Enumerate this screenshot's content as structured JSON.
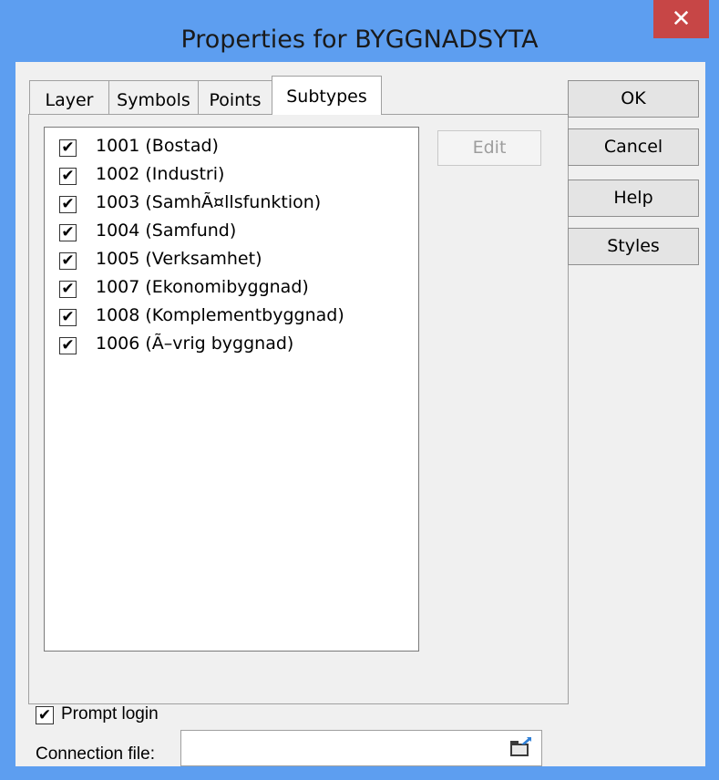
{
  "window": {
    "title": "Properties for BYGGNADSYTA",
    "close_glyph": "✕"
  },
  "tabs": [
    {
      "label": "Layer"
    },
    {
      "label": "Symbols"
    },
    {
      "label": "Points"
    },
    {
      "label": "Subtypes",
      "active": true
    }
  ],
  "subtypes": {
    "items": [
      {
        "label": "1001 (Bostad)",
        "checked": true
      },
      {
        "label": "1002 (Industri)",
        "checked": true
      },
      {
        "label": "1003 (SamhÃ¤llsfunktion)",
        "checked": true
      },
      {
        "label": "1004 (Samfund)",
        "checked": true
      },
      {
        "label": "1005 (Verksamhet)",
        "checked": true
      },
      {
        "label": "1007 (Ekonomibyggnad)",
        "checked": true
      },
      {
        "label": "1008 (Komplementbyggnad)",
        "checked": true
      },
      {
        "label": "1006 (Ã–vrig byggnad)",
        "checked": true
      }
    ],
    "edit_label": "Edit",
    "check_glyph": "✔"
  },
  "buttons": {
    "ok": "OK",
    "cancel": "Cancel",
    "help": "Help",
    "styles": "Styles"
  },
  "prompt_login": {
    "label": "Prompt login",
    "checked": true
  },
  "connection": {
    "label": "Connection file:",
    "value": ""
  },
  "icons": {
    "close": "close-icon",
    "browse": "open-folder-icon",
    "checkbox": "checkmark-icon"
  }
}
